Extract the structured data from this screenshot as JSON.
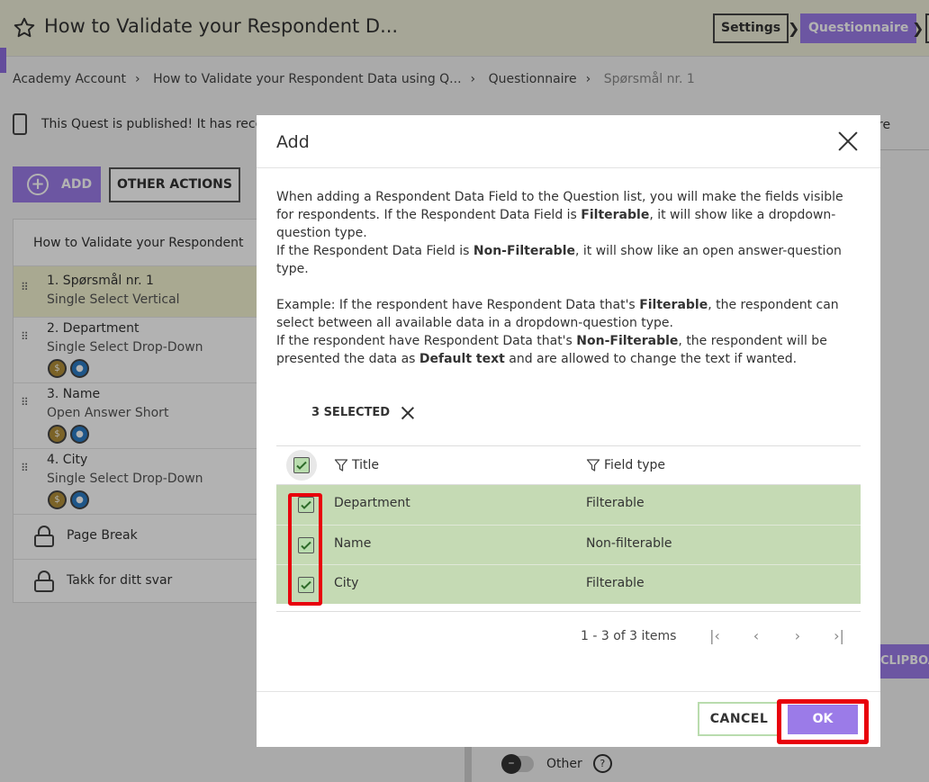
{
  "header": {
    "title": "How to Validate your Respondent D...",
    "steps": {
      "settings": "Settings",
      "questionnaire": "Questionnaire"
    }
  },
  "breadcrumb": [
    "Academy Account",
    "How to Validate your Respondent Data using Q...",
    "Questionnaire",
    "Spørsmål nr. 1"
  ],
  "notice": {
    "text": "This Quest is published! It has recei",
    "right_fragment": "re"
  },
  "toolbar": {
    "add_label": "ADD",
    "other_actions_label": "OTHER ACTIONS"
  },
  "question_list": {
    "header": "How to Validate your Respondent",
    "items": [
      {
        "num": "1.  Spørsmål nr. 1",
        "type": "Single Select Vertical",
        "badges": false
      },
      {
        "num": "2.  Department",
        "type": "Single Select Drop-Down",
        "badges": true
      },
      {
        "num": "3.  Name",
        "type": "Open Answer Short",
        "badges": true
      },
      {
        "num": "4.  City",
        "type": "Single Select Drop-Down",
        "badges": true
      }
    ],
    "page_break": "Page Break",
    "thanks": "Takk for ditt svar"
  },
  "right_panel": {
    "clipboard_fragment": "CLIPBOA",
    "other_label": "Other"
  },
  "modal": {
    "title": "Add",
    "description": {
      "p1a": "When adding a Respondent Data Field to the Question list, you will make the fields visible for respondents. If the Respondent Data Field is ",
      "p1b": "Filterable",
      "p1c": ", it will show like a dropdown-question type.",
      "p2a": "If the Respondent Data Field is ",
      "p2b": "Non-Filterable",
      "p2c": ", it will show like an open answer-question type.",
      "p3a": "Example: If the respondent have Respondent Data that's ",
      "p3b": "Filterable",
      "p3c": ", the respondent can select between all available data in a dropdown-question type.",
      "p4a": "If the respondent have Respondent Data that's ",
      "p4b": "Non-Filterable",
      "p4c": ", the respondent will be presented the data as ",
      "p4d": "Default text",
      "p4e": " and are allowed to change the text if wanted."
    },
    "selected_label": "3 SELECTED",
    "columns": {
      "title": "Title",
      "field_type": "Field type"
    },
    "rows": [
      {
        "title": "Department",
        "field_type": "Filterable",
        "checked": true
      },
      {
        "title": "Name",
        "field_type": "Non-filterable",
        "checked": true
      },
      {
        "title": "City",
        "field_type": "Filterable",
        "checked": true
      }
    ],
    "pagination": "1 - 3 of 3 items",
    "cancel_label": "CANCEL",
    "ok_label": "OK"
  },
  "colors": {
    "accent": "#9b7be8",
    "selected_row": "#c5dab4",
    "highlight": "#e8000b"
  }
}
